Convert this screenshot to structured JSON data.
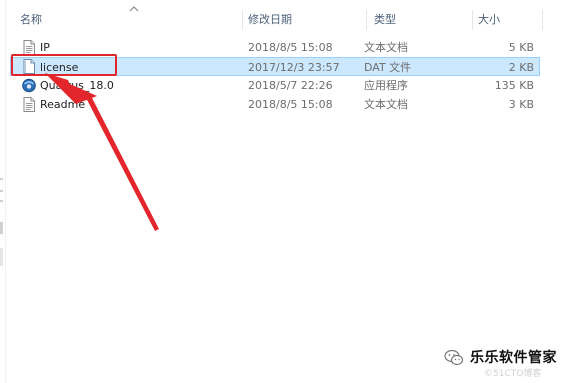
{
  "columns": {
    "name": "名称",
    "date": "修改日期",
    "type": "类型",
    "size": "大小"
  },
  "files": [
    {
      "name": "IP",
      "date": "2018/8/5 15:08",
      "type": "文本文档",
      "size": "5 KB",
      "icon": "text-document-icon"
    },
    {
      "name": "license",
      "date": "2017/12/3 23:57",
      "type": "DAT 文件",
      "size": "2 KB",
      "icon": "generic-file-icon",
      "selected": true
    },
    {
      "name": "Quartus_18.0",
      "date": "2018/5/7 22:26",
      "type": "应用程序",
      "size": "135 KB",
      "icon": "application-icon"
    },
    {
      "name": "Readme",
      "date": "2018/8/5 15:08",
      "type": "文本文档",
      "size": "3 KB",
      "icon": "text-document-icon"
    }
  ],
  "annotation": {
    "highlight_color": "#e3262b"
  },
  "watermark": {
    "title": "乐乐软件管家",
    "subtitle": "©51CTO博客"
  },
  "colors": {
    "selection_bg": "#cce8ff",
    "selection_border": "#99d1ff",
    "header_text": "#4c607a"
  }
}
